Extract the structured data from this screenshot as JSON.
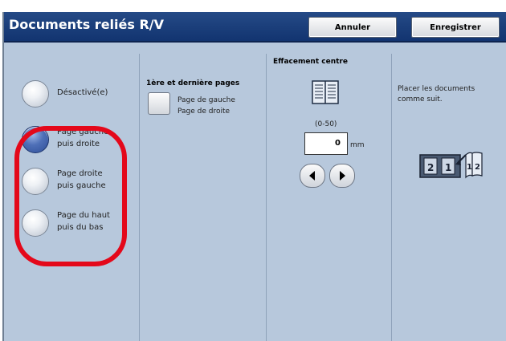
{
  "window": {
    "title": "Documents reliés R/V"
  },
  "toolbar": {
    "cancel_label": "Annuler",
    "save_label": "Enregistrer"
  },
  "options": [
    {
      "label": "Désactivé(e)",
      "selected": false
    },
    {
      "label": "Page gauche puis droite",
      "selected": true
    },
    {
      "label": "Page droite puis gauche",
      "selected": false
    },
    {
      "label": "Page du haut puis du bas",
      "selected": false
    }
  ],
  "pages": {
    "title": "1ère et dernière pages",
    "line1": "Page de gauche",
    "line2": "Page de droite"
  },
  "erase": {
    "title": "Effacement centre",
    "range": "(0-50)",
    "value": "0",
    "unit": "mm"
  },
  "info": {
    "text": "Placer les documents comme suit."
  },
  "colors": {
    "accent": "#e4081a",
    "titlebar": "#1b3f7b",
    "background": "#b7c8dc"
  }
}
